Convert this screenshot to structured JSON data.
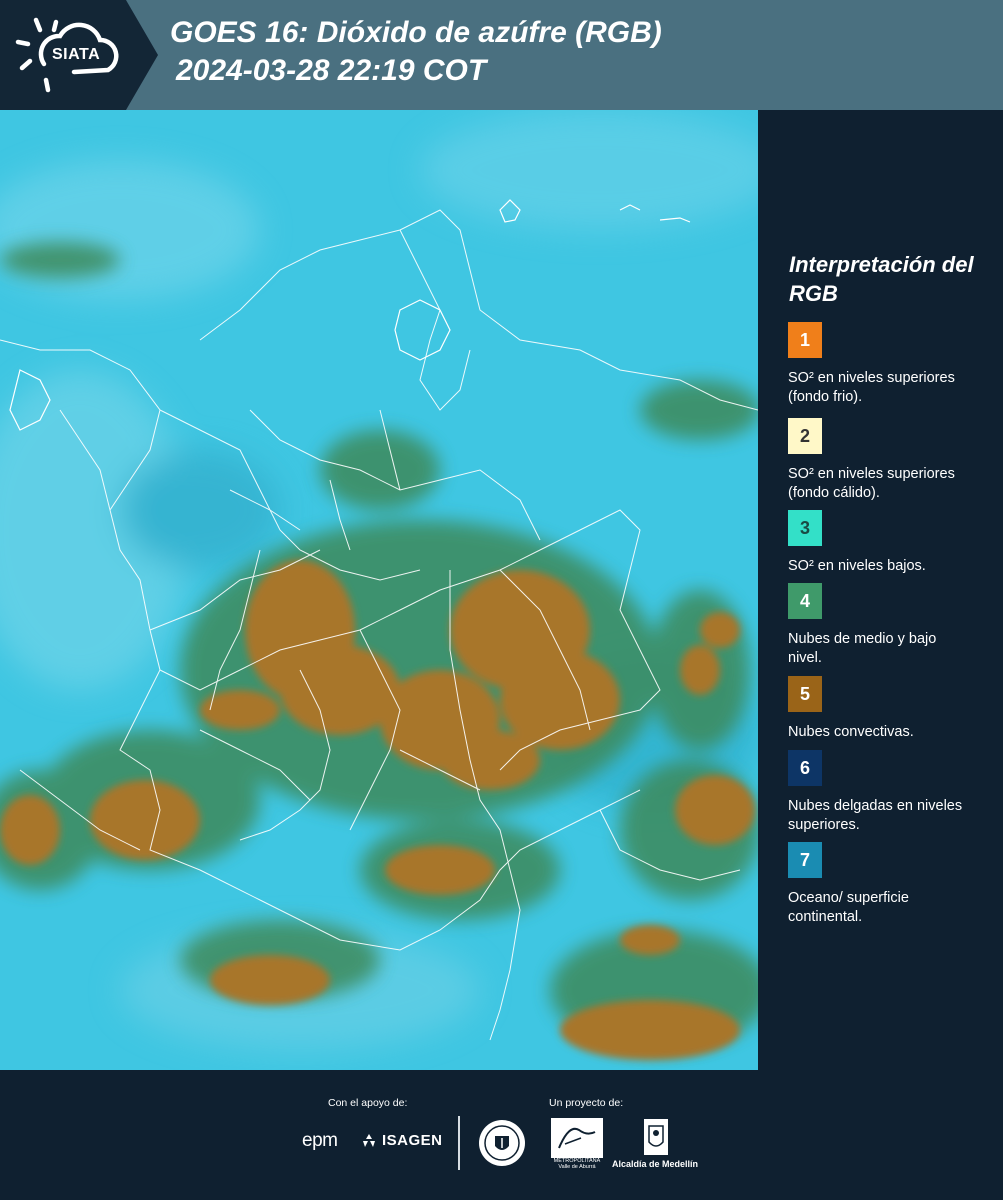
{
  "header": {
    "logo_text": "SIATA",
    "title_line1": "GOES 16: Dióxido de azúfre (RGB)",
    "title_line2": "2024-03-28 22:19 COT"
  },
  "map": {
    "icon": "satellite-rgb-map",
    "colors": {
      "background": "#3ec8e0",
      "convective": "#a8762a",
      "mid_low": "#3d8a5c",
      "borders": "#ffffff"
    }
  },
  "legend": {
    "title": "Interpretación del RGB",
    "items": [
      {
        "number": "1",
        "color": "#f07f1a",
        "text_color": "#ffffff",
        "label": "SO² en niveles superiores (fondo frio)."
      },
      {
        "number": "2",
        "color": "#fff8c8",
        "text_color": "#333333",
        "label": "SO² en niveles superiores (fondo cálido)."
      },
      {
        "number": "3",
        "color": "#33e0c8",
        "text_color": "#1a4a44",
        "label": "SO² en niveles bajos."
      },
      {
        "number": "4",
        "color": "#3f9a6a",
        "text_color": "#ffffff",
        "label": "Nubes de medio y bajo nivel."
      },
      {
        "number": "5",
        "color": "#9a6418",
        "text_color": "#ffffff",
        "label": "Nubes convectivas."
      },
      {
        "number": "6",
        "color": "#0d3566",
        "text_color": "#ffffff",
        "label": "Nubes delgadas en niveles superiores."
      },
      {
        "number": "7",
        "color": "#1a8cb2",
        "text_color": "#ffffff",
        "label": "Oceano/ superficie continental."
      }
    ]
  },
  "footer": {
    "support_label": "Con el apoyo de:",
    "project_label": "Un proyecto de:",
    "epm": "epm",
    "isagen": "ISAGEN",
    "amva_label": "METROPOLITANA Valle de Aburrá",
    "alcaldia_label": "Alcaldía de Medellín"
  }
}
